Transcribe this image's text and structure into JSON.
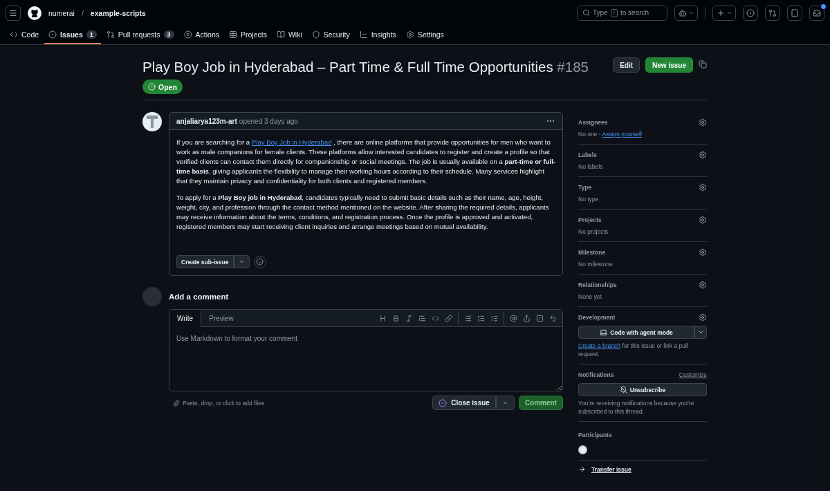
{
  "header": {
    "org": "numerai",
    "separator": "/",
    "repo": "example-scripts",
    "search": {
      "before": "Type",
      "key": "/",
      "after": "to search"
    }
  },
  "nav_tabs": [
    {
      "label": "Code",
      "selected": false
    },
    {
      "label": "Issues",
      "count": "1",
      "selected": true
    },
    {
      "label": "Pull requests",
      "count": "3",
      "selected": false
    },
    {
      "label": "Actions",
      "selected": false
    },
    {
      "label": "Projects",
      "selected": false
    },
    {
      "label": "Wiki",
      "selected": false
    },
    {
      "label": "Security",
      "selected": false
    },
    {
      "label": "Insights",
      "selected": false
    },
    {
      "label": "Settings",
      "selected": false
    }
  ],
  "issue": {
    "title": "Play Boy Job in Hyderabad – Part Time & Full Time Opportunities",
    "number": "#185",
    "status": "Open",
    "actions": [
      "Edit",
      "New issue"
    ]
  },
  "comment": {
    "author": "anjaliarya123m-art",
    "meta": "opened 3 days ago",
    "paragraphs": [
      [
        {
          "kind": "text",
          "text": "If you are searching for a "
        },
        {
          "kind": "link",
          "text": "Play Boy Job in Hyderabad"
        },
        {
          "kind": "text",
          "text": " , there are online platforms that provide opportunities for men who want to work as male companions for female clients. These platforms allow interested candidates to register and create a profile so that verified clients can contact them directly for companionship or social meetings. The job is usually available on a **part-time or full-time basis**, giving applicants the flexibility to manage their working hours according to their schedule. Many services highlight that they maintain privacy and confidentiality for both clients and registered members."
        }
      ],
      [
        {
          "kind": "text",
          "text": "To apply for a **Play Boy job in Hyderabad**, candidates typically need to submit basic details such as their name, age, height, weight, city, and profession through the contact method mentioned on the website. After sharing the required details, applicants may receive information about the terms, conditions, and registration process. Once the profile is approved and activated, registered members may start receiving client inquiries and arrange meetings based on mutual availability."
        }
      ]
    ],
    "sub_issue_button": "Create sub-issue"
  },
  "composer": {
    "heading": "Add a comment",
    "tabs": [
      {
        "label": "Write",
        "selected": true
      },
      {
        "label": "Preview",
        "selected": false
      }
    ],
    "placeholder": "Use Markdown to format your comment",
    "attach_hint": "Paste, drop, or click to add files",
    "close_button": "Close issue",
    "comment_button": "Comment"
  },
  "sidebar": [
    {
      "kind": "field",
      "title": "Assignees",
      "value": "No one - ",
      "link": "Assign yourself"
    },
    {
      "kind": "field",
      "title": "Labels",
      "value": "No labels"
    },
    {
      "kind": "field",
      "title": "Type",
      "value": "No type"
    },
    {
      "kind": "field",
      "title": "Projects",
      "value": "No projects"
    },
    {
      "kind": "field",
      "title": "Milestone",
      "value": "No milestone"
    },
    {
      "kind": "field",
      "title": "Relationships",
      "value": "None yet"
    },
    {
      "kind": "development",
      "title": "Development",
      "button": "Code with agent mode",
      "link": "Create a branch",
      "value": " for this issue or link a pull request."
    },
    {
      "kind": "notifications",
      "title": "Notifications",
      "action": "Customize",
      "button": "Unsubscribe",
      "value": "You’re receiving notifications because you’re subscribed to this thread."
    },
    {
      "kind": "participants",
      "title": "Participants"
    },
    {
      "kind": "transfer",
      "title": "Transfer issue"
    }
  ]
}
